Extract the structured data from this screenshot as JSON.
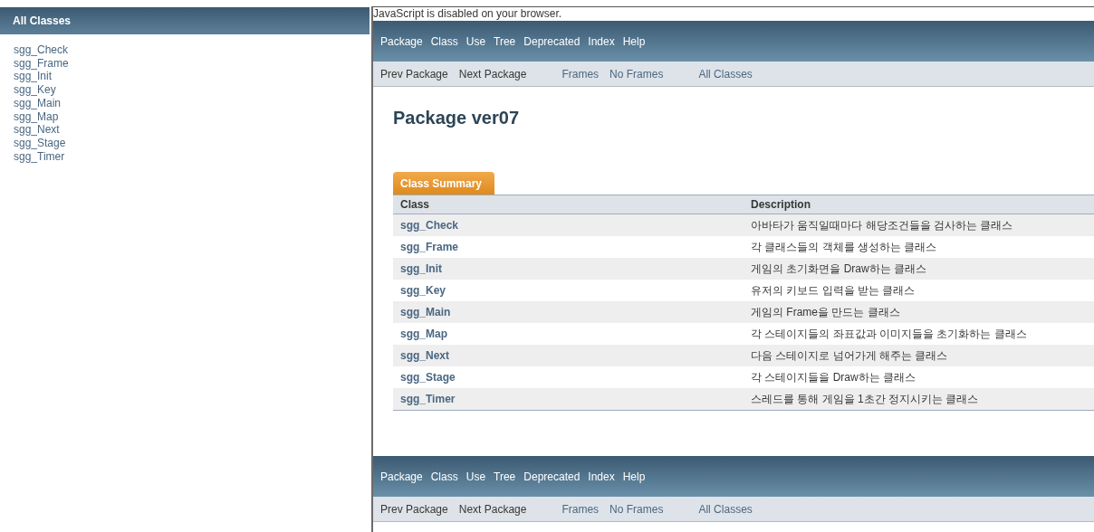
{
  "sidebar": {
    "title": "All Classes",
    "items": [
      "sgg_Check",
      "sgg_Frame",
      "sgg_Init",
      "sgg_Key",
      "sgg_Main",
      "sgg_Map",
      "sgg_Next",
      "sgg_Stage",
      "sgg_Timer"
    ]
  },
  "notice": "JavaScript is disabled on your browser.",
  "top_nav": {
    "menu": [
      "Package",
      "Class",
      "Use",
      "Tree",
      "Deprecated",
      "Index",
      "Help"
    ],
    "sub_nav": [
      {
        "label": "Prev Package",
        "kind": "text"
      },
      {
        "label": "Next Package",
        "kind": "text"
      },
      {
        "label": "Frames",
        "kind": "link"
      },
      {
        "label": "No Frames",
        "kind": "link"
      },
      {
        "label": "All Classes",
        "kind": "link"
      }
    ]
  },
  "page_title": "Package ver07",
  "summary": {
    "tab": "Class Summary",
    "columns": [
      "Class",
      "Description"
    ],
    "rows": [
      {
        "name": "sgg_Check",
        "description": "아바타가 움직일때마다 해당조건들을 검사하는 클래스"
      },
      {
        "name": "sgg_Frame",
        "description": "각 클래스들의 객체를 생성하는 클래스"
      },
      {
        "name": "sgg_Init",
        "description": "게임의 초기화면을 Draw하는 클래스"
      },
      {
        "name": "sgg_Key",
        "description": "유저의 키보드 입력을 받는 클래스"
      },
      {
        "name": "sgg_Main",
        "description": "게임의 Frame을 만드는 클래스"
      },
      {
        "name": "sgg_Map",
        "description": "각 스테이지들의 좌표값과 이미지들을 초기화하는 클래스"
      },
      {
        "name": "sgg_Next",
        "description": "다음 스테이지로 넘어가게 해주는 클래스"
      },
      {
        "name": "sgg_Stage",
        "description": "각 스테이지들을 Draw하는 클래스"
      },
      {
        "name": "sgg_Timer",
        "description": "스레드를 통해 게임을 1초간 정지시키는 클래스"
      }
    ]
  },
  "bottom_nav": {
    "menu": [
      "Package",
      "Class",
      "Use",
      "Tree",
      "Deprecated",
      "Index",
      "Help"
    ],
    "sub_nav": [
      {
        "label": "Prev Package",
        "kind": "text"
      },
      {
        "label": "Next Package",
        "kind": "text"
      },
      {
        "label": "Frames",
        "kind": "link"
      },
      {
        "label": "No Frames",
        "kind": "link"
      },
      {
        "label": "All Classes",
        "kind": "link"
      }
    ]
  }
}
